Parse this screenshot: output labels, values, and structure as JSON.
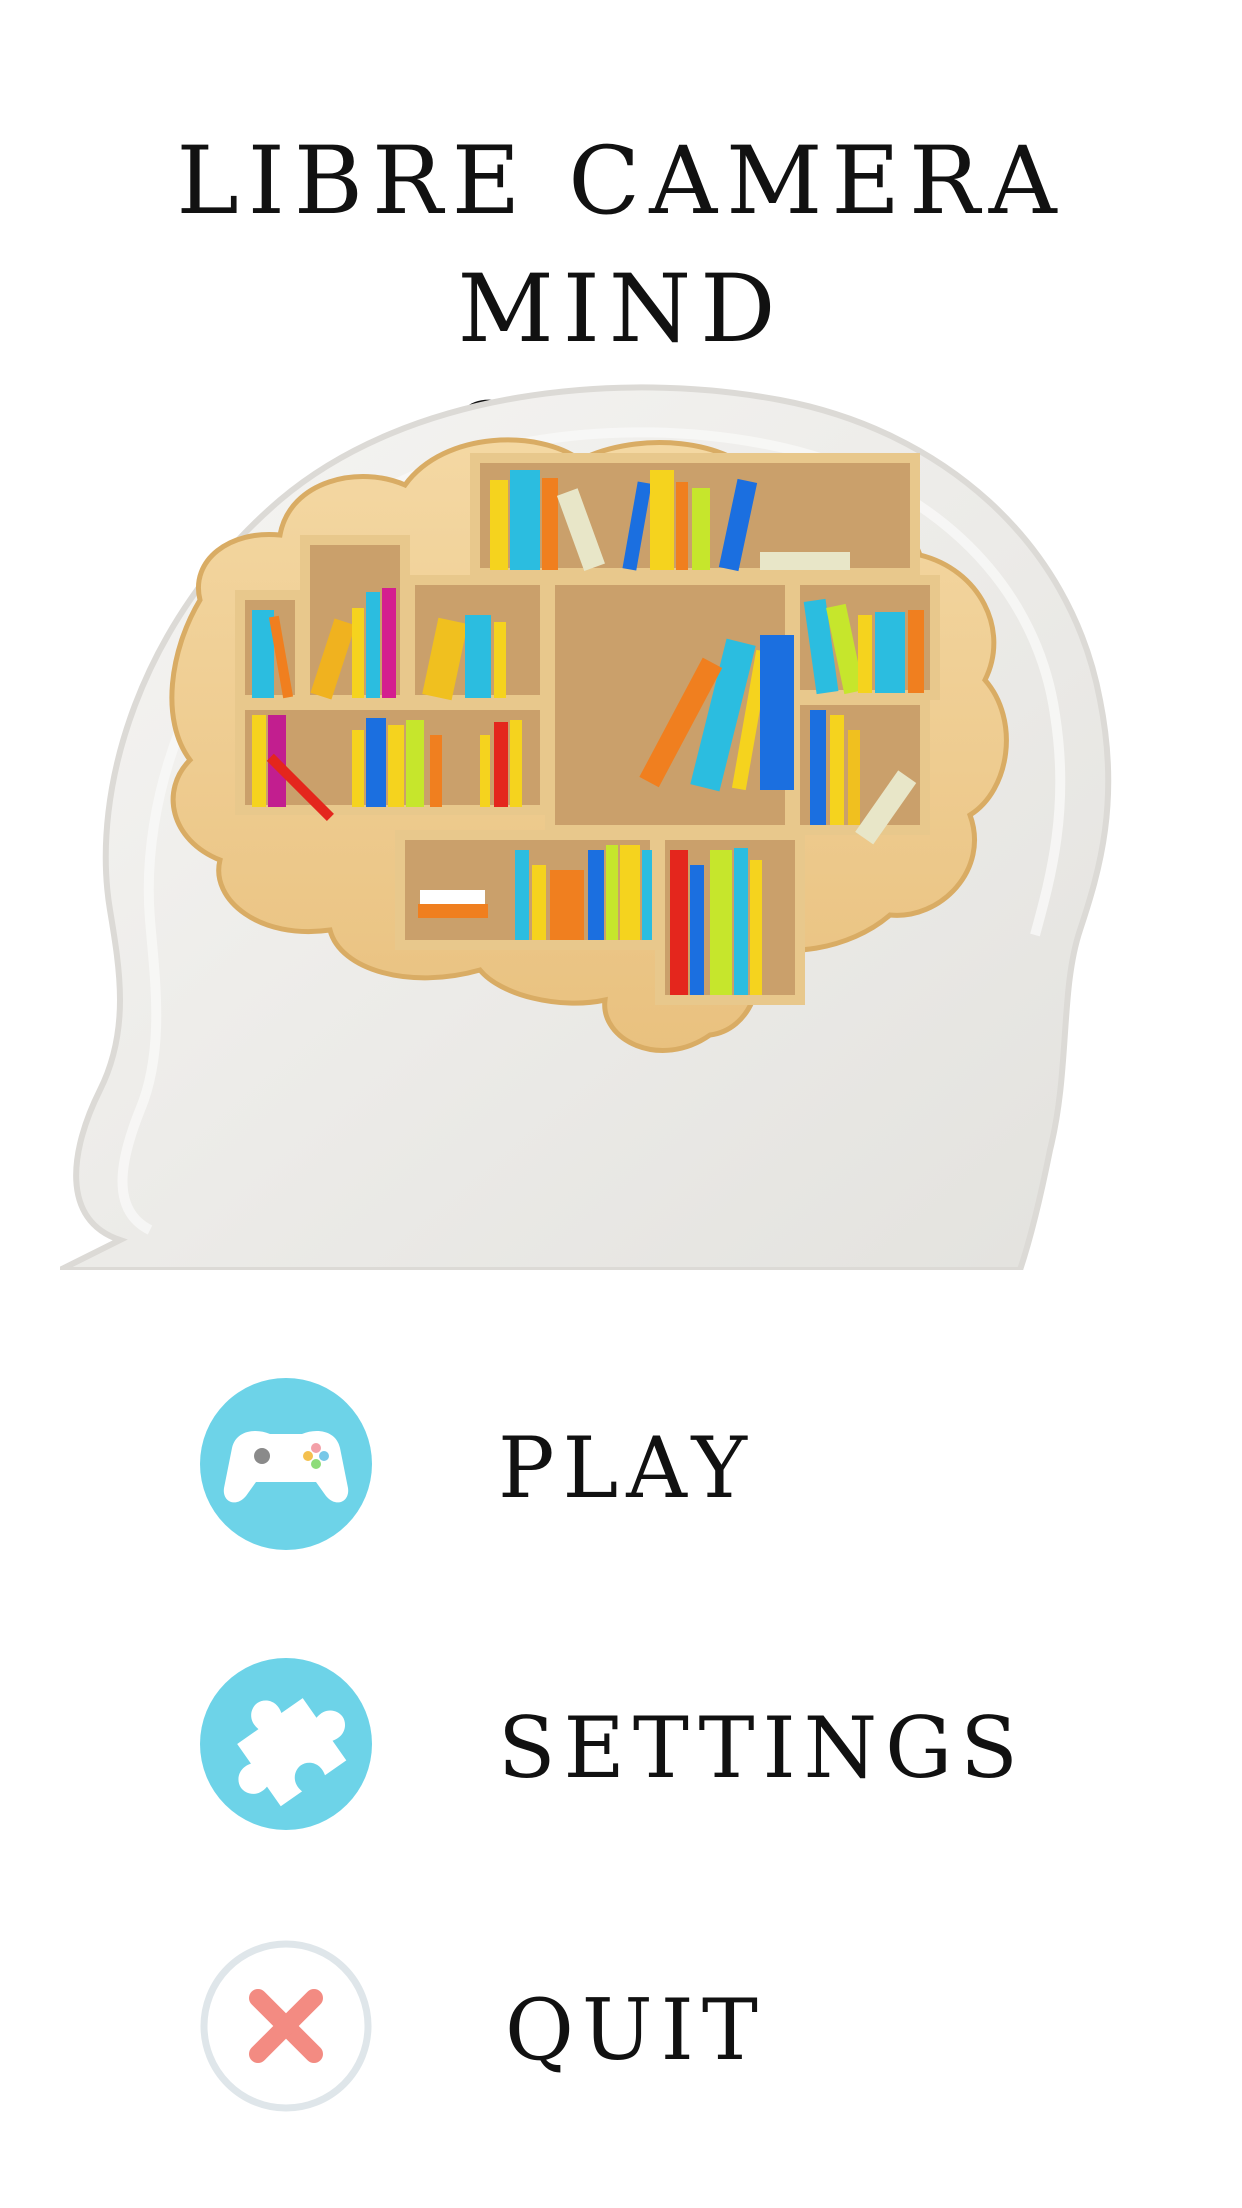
{
  "title": {
    "line1": "LIBRE CAMERA MIND",
    "line2": "GAME"
  },
  "menu": {
    "play": {
      "label": "PLAY",
      "icon": "gamepad-icon"
    },
    "settings": {
      "label": "SETTINGS",
      "icon": "puzzle-icon"
    },
    "quit": {
      "label": "QUIT",
      "icon": "close-icon"
    }
  },
  "colors": {
    "icon_circle": "#6dd3e8",
    "quit_circle_border": "#dfe6ea",
    "quit_x": "#f38b82",
    "head": "#ecebe8",
    "shelf_wood": "#efcd92"
  }
}
